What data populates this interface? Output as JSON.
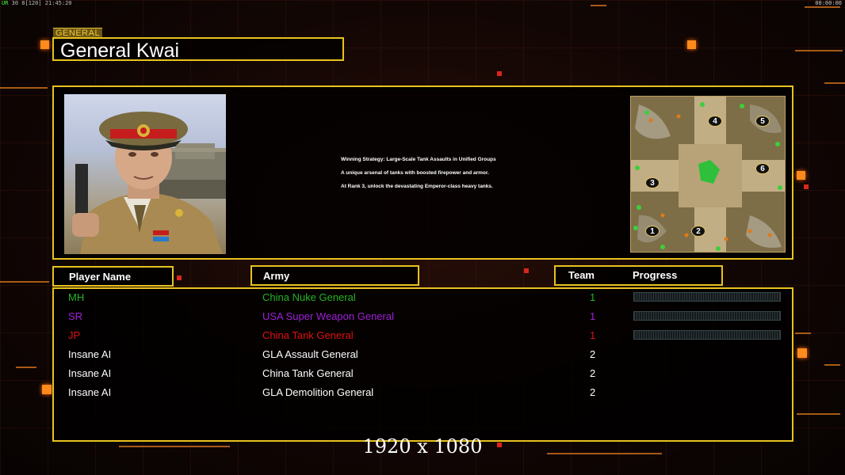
{
  "status_bar": {
    "left_prefix": "UR",
    "left_text": " 30 8[120] 21:45:20",
    "right_text": "00:00:00"
  },
  "general": {
    "tag": "GENERAL",
    "name": "General Kwai"
  },
  "strategy": {
    "lines": [
      "Winning Strategy: Large-Scale Tank Assaults in Unified Groups",
      "A unique arsenal of tanks with boosted firepower and armor.",
      "At Rank 3, unlock the devastating Emperor-class heavy tanks."
    ]
  },
  "minimap": {
    "start_markers": [
      "4",
      "5",
      "6",
      "3",
      "1",
      "2"
    ]
  },
  "headers": {
    "player": "Player Name",
    "army": "Army",
    "team": "Team",
    "progress": "Progress"
  },
  "players": [
    {
      "name": "MH",
      "army": "China Nuke General",
      "team": "1",
      "color": "#22b422",
      "progress": 0
    },
    {
      "name": "SR",
      "army": "USA Super Weapon General",
      "team": "1",
      "color": "#a020d8",
      "progress": 0
    },
    {
      "name": "JP",
      "army": "China Tank General",
      "team": "1",
      "color": "#e01010",
      "progress": 0
    },
    {
      "name": "Insane AI",
      "army": "GLA Assault General",
      "team": "2",
      "color": "#ffffff"
    },
    {
      "name": "Insane AI",
      "army": "China Tank General",
      "team": "2",
      "color": "#ffffff"
    },
    {
      "name": "Insane AI",
      "army": "GLA Demolition General",
      "team": "2",
      "color": "#ffffff"
    }
  ],
  "resolution_label": "1920 x 1080",
  "colors": {
    "frame": "#e8c21f",
    "accent": "#ff8a1e"
  }
}
